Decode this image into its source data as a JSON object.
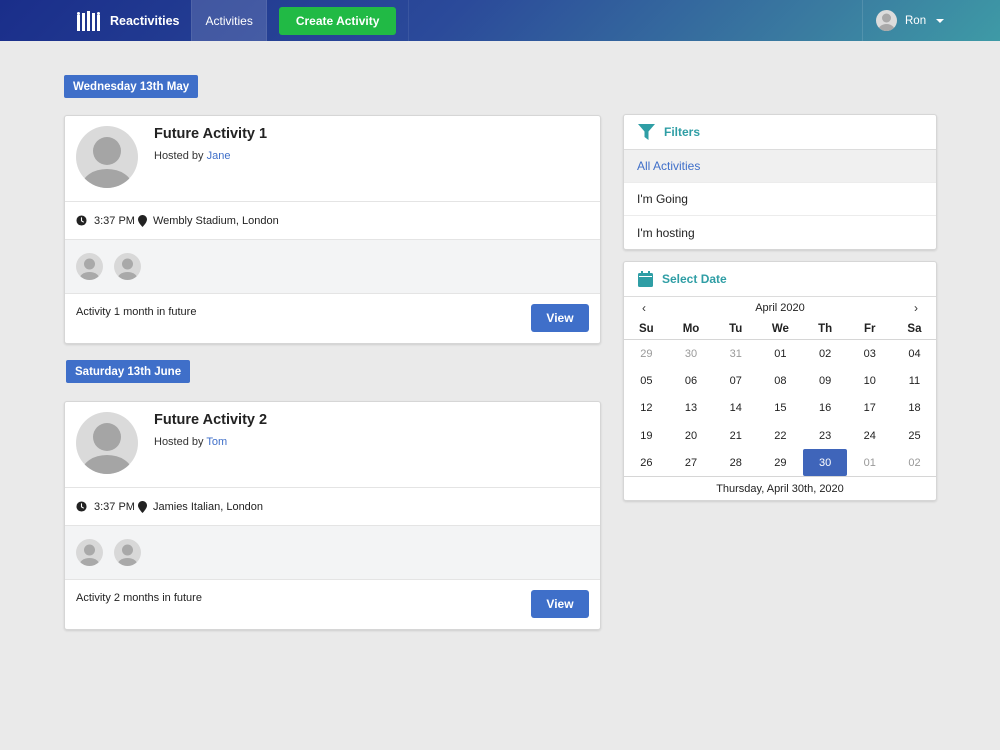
{
  "nav": {
    "brand": "Reactivities",
    "activities": "Activities",
    "create_activity": "Create Activity",
    "user_name": "Ron"
  },
  "groups": [
    {
      "date": "Wednesday 13th May",
      "activity": {
        "title": "Future Activity 1",
        "hosted_prefix": "Hosted by",
        "host": "Jane",
        "time": "3:37 PM",
        "venue": "Wembly Stadium, London",
        "description": "Activity 1 month in future",
        "view_label": "View"
      }
    },
    {
      "date": "Saturday 13th June",
      "activity": {
        "title": "Future Activity 2",
        "hosted_prefix": "Hosted by",
        "host": "Tom",
        "time": "3:37 PM",
        "venue": "Jamies Italian, London",
        "description": "Activity 2 months in future",
        "view_label": "View"
      }
    }
  ],
  "filters": {
    "title": "Filters",
    "items": [
      "All Activities",
      "I'm Going",
      "I'm hosting"
    ],
    "active_index": 0
  },
  "calendar": {
    "title": "Select Date",
    "month": "April 2020",
    "prev": "‹",
    "next": "›",
    "weekdays": [
      "Su",
      "Mo",
      "Tu",
      "We",
      "Th",
      "Fr",
      "Sa"
    ],
    "days": [
      [
        "29",
        "30",
        "31",
        "01",
        "02",
        "03",
        "04"
      ],
      [
        "05",
        "06",
        "07",
        "08",
        "09",
        "10",
        "11"
      ],
      [
        "12",
        "13",
        "14",
        "15",
        "16",
        "17",
        "18"
      ],
      [
        "19",
        "20",
        "21",
        "22",
        "23",
        "24",
        "25"
      ],
      [
        "26",
        "27",
        "28",
        "29",
        "30",
        "01",
        "02"
      ]
    ],
    "selected": "30",
    "footer": "Thursday, April 30th, 2020"
  },
  "colors": {
    "primary": "#3f6fc9",
    "green": "#21ba45",
    "teal": "#2f9ea5"
  }
}
